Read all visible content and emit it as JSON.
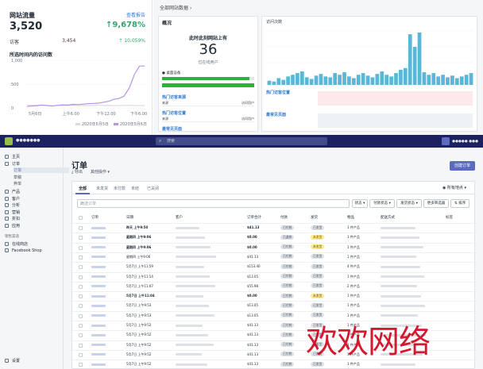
{
  "analytics": {
    "title": "网站流量",
    "link": "查看报告",
    "value": "3,520",
    "change": "↑9,678%",
    "row_label": "访客",
    "row_prev": "3,454",
    "row_change": "↑ 10,059%",
    "chart_title": "所选时间内的访问数",
    "chart_data": {
      "type": "line",
      "y_ticks": [
        "1,000",
        "500",
        "0"
      ],
      "x_ticks": [
        "5月6日",
        "上午6:00",
        "下午12:00",
        "下午6:00"
      ],
      "ylim": [
        0,
        1000
      ],
      "series": [
        {
          "name": "2020年5月5日",
          "color": "#dcdce0",
          "values": [
            60,
            55,
            50,
            58,
            50,
            45,
            52,
            50,
            48,
            55,
            50,
            52,
            48,
            50,
            55,
            50,
            52,
            48,
            50,
            52,
            55,
            50,
            48,
            52
          ]
        },
        {
          "name": "2020年5月6日",
          "color": "#b794e3",
          "values": [
            30,
            40,
            50,
            60,
            50,
            40,
            55,
            65,
            60,
            75,
            70,
            80,
            90,
            95,
            100,
            120,
            140,
            180,
            200,
            250,
            420,
            700,
            880,
            880
          ]
        }
      ]
    }
  },
  "live": {
    "header": "全部网站数据 ›",
    "card_title": "概况",
    "now_label": "此时此刻网站上有",
    "visitors": "36",
    "visitors_caption": "位在线用户",
    "device_label": "● 桌面设备",
    "device_pct": 95,
    "sec_source": "热门访客来源",
    "sec_location": "热门访客位置",
    "sec_pages": "最常见页面",
    "rows": [
      {
        "a": "来源",
        "b": "访问用户"
      },
      {
        "a": "来源",
        "b": "访问用户"
      }
    ],
    "right_title": "访问次数",
    "right_sec1": "热门访客位置",
    "right_sec2": "最常见页面",
    "bars": [
      5,
      4,
      8,
      6,
      10,
      12,
      14,
      16,
      9,
      7,
      11,
      13,
      10,
      9,
      14,
      12,
      15,
      10,
      8,
      12,
      14,
      11,
      9,
      13,
      16,
      12,
      10,
      14,
      18,
      20,
      60,
      45,
      62,
      15,
      12,
      14,
      10,
      12,
      9,
      11,
      8,
      10,
      12,
      14
    ]
  },
  "app": {
    "store": "●●●●●●●",
    "search": "搜索",
    "account": "●●●●● ●●●",
    "nav": [
      {
        "label": "主页",
        "icon": "home-icon"
      },
      {
        "label": "订单",
        "icon": "orders-icon"
      },
      {
        "label": "订单",
        "icon": "",
        "sub": true,
        "active": true
      },
      {
        "label": "草稿",
        "icon": "",
        "sub": true
      },
      {
        "label": "弃单",
        "icon": "",
        "sub": true
      },
      {
        "label": "产品",
        "icon": "tag-icon"
      },
      {
        "label": "客户",
        "icon": "customer-icon"
      },
      {
        "label": "分析",
        "icon": "analytics-icon"
      },
      {
        "label": "营销",
        "icon": "marketing-icon"
      },
      {
        "label": "折扣",
        "icon": "discount-icon"
      },
      {
        "label": "应用",
        "icon": "apps-icon"
      }
    ],
    "channels_caption": "销售渠道",
    "channels": [
      "在线商店",
      "Facebook Shop"
    ],
    "settings": "设置",
    "page_title": "订单",
    "actions": [
      "导出",
      "其他操作 ▾"
    ],
    "create_btn": "创建订单",
    "tabs": [
      "全部",
      "未发货",
      "未付款",
      "未结",
      "已关闭"
    ],
    "location": "◉ 所有地点 ▾",
    "filter_placeholder": "筛选订单",
    "filter_buttons": [
      "状态 ▾",
      "付款状态 ▾",
      "发货状态 ▾",
      "更多筛选器",
      "⇅ 排序"
    ],
    "columns": [
      "订单",
      "日期",
      "客户",
      "订单合计",
      "付款",
      "发货",
      "物品",
      "配送方式",
      "标签"
    ],
    "rows": [
      {
        "date": "昨天 上午9:50",
        "total": "$41.13",
        "pay": "已付款",
        "ship": "已发货",
        "ship_y": false,
        "items": "1 件产品",
        "bold": true
      },
      {
        "date": "星期四 上午9:06",
        "total": "$0.00",
        "pay": "已退款",
        "ship": "未发货",
        "ship_y": true,
        "items": "1 件产品",
        "bold": true
      },
      {
        "date": "星期四 上午9:06",
        "total": "$0.00",
        "pay": "已付款",
        "ship": "未发货",
        "ship_y": true,
        "items": "1 件产品",
        "bold": true
      },
      {
        "date": "星期四 上午9:06",
        "total": "$41.13",
        "pay": "已付款",
        "ship": "已发货",
        "ship_y": false,
        "items": "1 件产品",
        "bold": false
      },
      {
        "date": "5月7日 上午11:59",
        "total": "$153.40",
        "pay": "已付款",
        "ship": "已发货",
        "ship_y": false,
        "items": "4 件产品",
        "bold": false
      },
      {
        "date": "5月7日 上午11:14",
        "total": "$13.05",
        "pay": "已付款",
        "ship": "已发货",
        "ship_y": false,
        "items": "1 件产品",
        "bold": false
      },
      {
        "date": "5月7日 上午11:07",
        "total": "$55.98",
        "pay": "已付款",
        "ship": "已发货",
        "ship_y": false,
        "items": "2 件产品",
        "bold": false
      },
      {
        "date": "5月7日 上午11:04",
        "total": "$0.00",
        "pay": "已付款",
        "ship": "未发货",
        "ship_y": true,
        "items": "1 件产品",
        "bold": true
      },
      {
        "date": "5月7日 上午9:53",
        "total": "$13.05",
        "pay": "已付款",
        "ship": "已发货",
        "ship_y": false,
        "items": "1 件产品",
        "bold": false
      },
      {
        "date": "5月7日 上午9:53",
        "total": "$13.05",
        "pay": "已付款",
        "ship": "已发货",
        "ship_y": false,
        "items": "1 件产品",
        "bold": false
      },
      {
        "date": "5月7日 上午9:52",
        "total": "$41.13",
        "pay": "已付款",
        "ship": "已发货",
        "ship_y": false,
        "items": "1 件产品",
        "bold": false
      },
      {
        "date": "5月7日 上午9:52",
        "total": "$41.13",
        "pay": "已付款",
        "ship": "已发货",
        "ship_y": false,
        "items": "1 件产品",
        "bold": false
      },
      {
        "date": "5月7日 上午9:52",
        "total": "$41.13",
        "pay": "已付款",
        "ship": "已发货",
        "ship_y": false,
        "items": "1 件产品",
        "bold": false
      },
      {
        "date": "5月7日 上午9:52",
        "total": "$41.13",
        "pay": "已付款",
        "ship": "已发货",
        "ship_y": false,
        "items": "1 件产品",
        "bold": false
      },
      {
        "date": "5月7日 上午9:52",
        "total": "$41.13",
        "pay": "已付款",
        "ship": "已发货",
        "ship_y": false,
        "items": "1 件产品",
        "bold": false
      }
    ]
  },
  "watermark": "欢欢网络",
  "colors": {
    "accent": "#5c6ac4",
    "topbar": "#1c2260",
    "green": "#27b33e",
    "live_bar": "#59b8d6"
  }
}
